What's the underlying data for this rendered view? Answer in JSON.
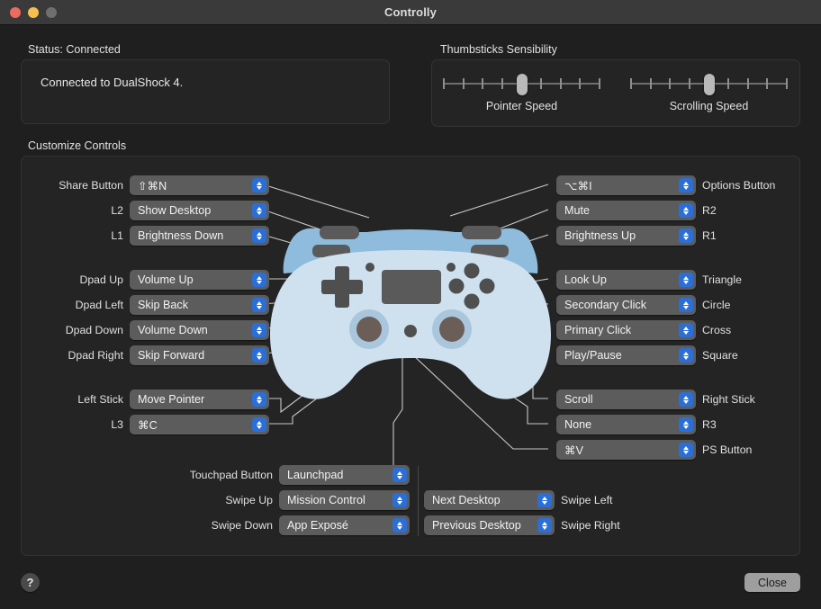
{
  "window": {
    "title": "Controlly",
    "traffic_lights": [
      "close",
      "minimize",
      "zoom"
    ]
  },
  "status": {
    "group_label": "Status: Connected",
    "message": "Connected to DualShock 4."
  },
  "thumbsticks": {
    "group_label": "Thumbsticks Sensibility",
    "sliders": [
      {
        "name": "pointer_speed",
        "caption": "Pointer Speed",
        "value_pct": 50,
        "ticks": 9
      },
      {
        "name": "scrolling_speed",
        "caption": "Scrolling Speed",
        "value_pct": 50,
        "ticks": 9
      }
    ]
  },
  "customize": {
    "group_label": "Customize Controls",
    "left_rows": [
      {
        "label": "Share Button",
        "value": "⇧⌘N"
      },
      {
        "label": "L2",
        "value": "Show Desktop"
      },
      {
        "label": "L1",
        "value": "Brightness Down"
      },
      {
        "label": "Dpad Up",
        "value": "Volume Up"
      },
      {
        "label": "Dpad Left",
        "value": "Skip Back"
      },
      {
        "label": "Dpad Down",
        "value": "Volume Down"
      },
      {
        "label": "Dpad Right",
        "value": "Skip Forward"
      },
      {
        "label": "Left Stick",
        "value": "Move Pointer"
      },
      {
        "label": "L3",
        "value": "⌘C"
      }
    ],
    "right_rows": [
      {
        "label": "Options Button",
        "value": "⌥⌘I"
      },
      {
        "label": "R2",
        "value": "Mute"
      },
      {
        "label": "R1",
        "value": "Brightness Up"
      },
      {
        "label": "Triangle",
        "value": "Look Up"
      },
      {
        "label": "Circle",
        "value": "Secondary Click"
      },
      {
        "label": "Cross",
        "value": "Primary Click"
      },
      {
        "label": "Square",
        "value": "Play/Pause"
      },
      {
        "label": "Right Stick",
        "value": "Scroll"
      },
      {
        "label": "R3",
        "value": "None"
      },
      {
        "label": "PS Button",
        "value": "⌘V"
      }
    ],
    "bottom_left_rows": [
      {
        "label": "Touchpad Button",
        "value": "Launchpad"
      },
      {
        "label": "Swipe Up",
        "value": "Mission Control"
      },
      {
        "label": "Swipe Down",
        "value": "App Exposé"
      }
    ],
    "bottom_right_rows": [
      {
        "label": "Swipe Left",
        "value": "Next Desktop"
      },
      {
        "label": "Swipe Right",
        "value": "Previous Desktop"
      }
    ]
  },
  "footer": {
    "help_label": "?",
    "close_label": "Close"
  },
  "colors": {
    "window_background": "#201f1f",
    "titlebar": "#3a3a3a",
    "group_fill": "#242424",
    "group_border": "#333333",
    "popup_fill": "#5c5c5c",
    "stepper_blue": "#2b6fd6",
    "controller_body": "#cfe0ef",
    "controller_top": "#8fbcdc",
    "controller_dark": "#4f4f4f",
    "leader_line": "#d8d8d8",
    "close_button": "#9e9e9e"
  }
}
